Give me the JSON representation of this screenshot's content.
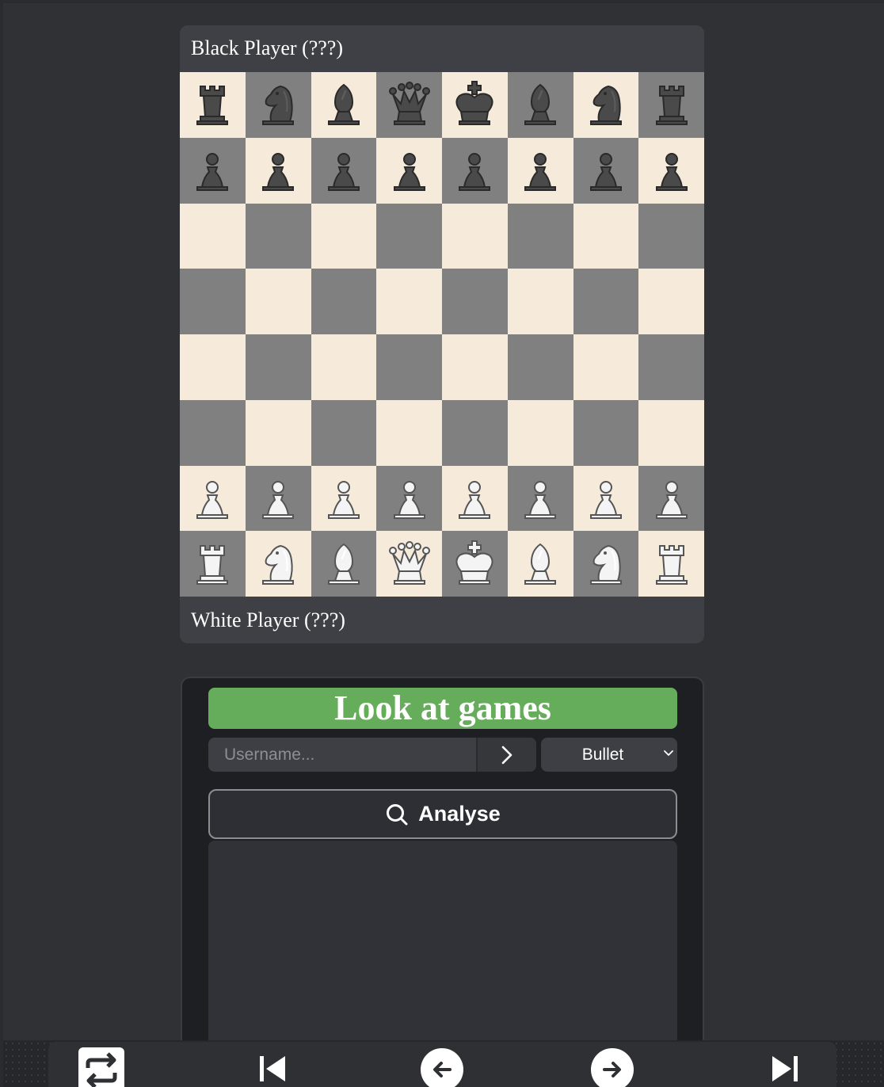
{
  "players": {
    "black": "Black Player (???)",
    "white": "White Player (???)"
  },
  "board": {
    "light_color": "#f6ebda",
    "dark_color": "#808080",
    "ranks": [
      [
        "r",
        "n",
        "b",
        "q",
        "k",
        "b",
        "n",
        "r"
      ],
      [
        "p",
        "p",
        "p",
        "p",
        "p",
        "p",
        "p",
        "p"
      ],
      [
        "",
        "",
        "",
        "",
        "",
        "",
        "",
        ""
      ],
      [
        "",
        "",
        "",
        "",
        "",
        "",
        "",
        ""
      ],
      [
        "",
        "",
        "",
        "",
        "",
        "",
        "",
        ""
      ],
      [
        "",
        "",
        "",
        "",
        "",
        "",
        "",
        ""
      ],
      [
        "P",
        "P",
        "P",
        "P",
        "P",
        "P",
        "P",
        "P"
      ],
      [
        "R",
        "N",
        "B",
        "Q",
        "K",
        "B",
        "N",
        "R"
      ]
    ]
  },
  "panel": {
    "title": "Look at games",
    "title_color": "#66ad5b",
    "username_placeholder": "Username...",
    "mode_selected": "Bullet",
    "analyse_label": "Analyse"
  },
  "nav": {
    "icons": [
      "flip-board-icon",
      "first-move-icon",
      "previous-move-icon",
      "next-move-icon",
      "last-move-icon"
    ]
  }
}
